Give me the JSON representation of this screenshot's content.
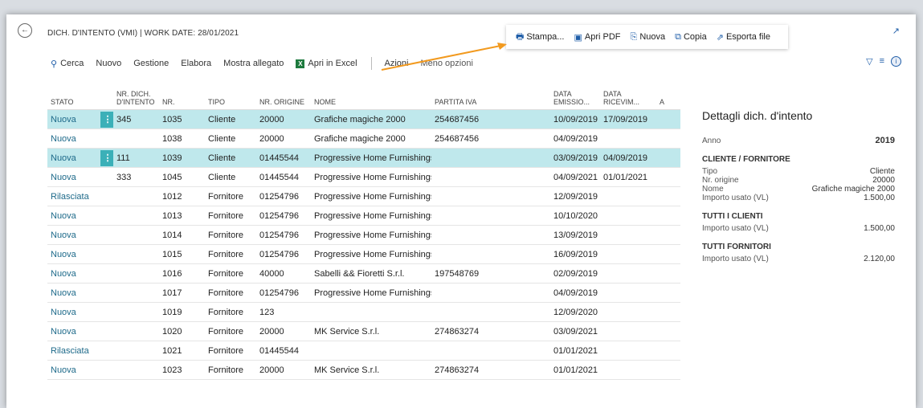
{
  "header": {
    "title": "DICH. D'INTENTO (VMI) | WORK DATE: 28/01/2021"
  },
  "float_actions": [
    {
      "label": "Stampa...",
      "icon": "printer-icon",
      "glyph": "🖶"
    },
    {
      "label": "Apri PDF",
      "icon": "save-icon",
      "glyph": "▣"
    },
    {
      "label": "Nuova",
      "icon": "new-document-icon",
      "glyph": "⎘"
    },
    {
      "label": "Copia",
      "icon": "copy-icon",
      "glyph": "⧉"
    },
    {
      "label": "Esporta file",
      "icon": "export-icon",
      "glyph": "⇗"
    }
  ],
  "actions": {
    "search": "Cerca",
    "new": "Nuovo",
    "manage": "Gestione",
    "process": "Elabora",
    "show_attachment": "Mostra allegato",
    "open_excel": "Apri in Excel",
    "actions": "Azioni",
    "fewer_options": "Meno opzioni"
  },
  "columns": [
    "STATO",
    "",
    "NR. DICH. D'INTENTO",
    "NR.",
    "TIPO",
    "NR. ORIGINE",
    "NOME",
    "PARTITA IVA",
    "DATA EMISSIO...",
    "DATA RICEVIM...",
    "A"
  ],
  "rows": [
    {
      "stato": "Nuova",
      "menu": true,
      "nr_dich": "345",
      "nr": "1035",
      "tipo": "Cliente",
      "origine": "20000",
      "nome": "Grafiche magiche 2000",
      "piva": "254687456",
      "emiss": "10/09/2019",
      "ricev": "17/09/2019",
      "sel": true
    },
    {
      "stato": "Nuova",
      "menu": false,
      "nr_dich": "",
      "nr": "1038",
      "tipo": "Cliente",
      "origine": "20000",
      "nome": "Grafiche magiche 2000",
      "piva": "254687456",
      "emiss": "04/09/2019",
      "ricev": "",
      "sel": false
    },
    {
      "stato": "Nuova",
      "menu": true,
      "nr_dich": "111",
      "nr": "1039",
      "tipo": "Cliente",
      "origine": "01445544",
      "nome": "Progressive Home Furnishings",
      "piva": "",
      "emiss": "03/09/2019",
      "ricev": "04/09/2019",
      "sel": true
    },
    {
      "stato": "Nuova",
      "menu": false,
      "nr_dich": "333",
      "nr": "1045",
      "tipo": "Cliente",
      "origine": "01445544",
      "nome": "Progressive Home Furnishings",
      "piva": "",
      "emiss": "04/09/2021",
      "ricev": "01/01/2021",
      "sel": false
    },
    {
      "stato": "Rilasciata",
      "menu": false,
      "nr_dich": "",
      "nr": "1012",
      "tipo": "Fornitore",
      "origine": "01254796",
      "nome": "Progressive Home Furnishings",
      "piva": "",
      "emiss": "12/09/2019",
      "ricev": "",
      "sel": false
    },
    {
      "stato": "Nuova",
      "menu": false,
      "nr_dich": "",
      "nr": "1013",
      "tipo": "Fornitore",
      "origine": "01254796",
      "nome": "Progressive Home Furnishings",
      "piva": "",
      "emiss": "10/10/2020",
      "ricev": "",
      "sel": false
    },
    {
      "stato": "Nuova",
      "menu": false,
      "nr_dich": "",
      "nr": "1014",
      "tipo": "Fornitore",
      "origine": "01254796",
      "nome": "Progressive Home Furnishings",
      "piva": "",
      "emiss": "13/09/2019",
      "ricev": "",
      "sel": false
    },
    {
      "stato": "Nuova",
      "menu": false,
      "nr_dich": "",
      "nr": "1015",
      "tipo": "Fornitore",
      "origine": "01254796",
      "nome": "Progressive Home Furnishings",
      "piva": "",
      "emiss": "16/09/2019",
      "ricev": "",
      "sel": false
    },
    {
      "stato": "Nuova",
      "menu": false,
      "nr_dich": "",
      "nr": "1016",
      "tipo": "Fornitore",
      "origine": "40000",
      "nome": "Sabelli && Fioretti S.r.l.",
      "piva": "197548769",
      "emiss": "02/09/2019",
      "ricev": "",
      "sel": false
    },
    {
      "stato": "Nuova",
      "menu": false,
      "nr_dich": "",
      "nr": "1017",
      "tipo": "Fornitore",
      "origine": "01254796",
      "nome": "Progressive Home Furnishings",
      "piva": "",
      "emiss": "04/09/2019",
      "ricev": "",
      "sel": false
    },
    {
      "stato": "Nuova",
      "menu": false,
      "nr_dich": "",
      "nr": "1019",
      "tipo": "Fornitore",
      "origine": "123",
      "nome": "",
      "piva": "",
      "emiss": "12/09/2020",
      "ricev": "",
      "sel": false
    },
    {
      "stato": "Nuova",
      "menu": false,
      "nr_dich": "",
      "nr": "1020",
      "tipo": "Fornitore",
      "origine": "20000",
      "nome": "MK Service S.r.l.",
      "piva": "274863274",
      "emiss": "03/09/2021",
      "ricev": "",
      "sel": false
    },
    {
      "stato": "Rilasciata",
      "menu": false,
      "nr_dich": "",
      "nr": "1021",
      "tipo": "Fornitore",
      "origine": "01445544",
      "nome": "",
      "piva": "",
      "emiss": "01/01/2021",
      "ricev": "",
      "sel": false
    },
    {
      "stato": "Nuova",
      "menu": false,
      "nr_dich": "",
      "nr": "1023",
      "tipo": "Fornitore",
      "origine": "20000",
      "nome": "MK Service S.r.l.",
      "piva": "274863274",
      "emiss": "01/01/2021",
      "ricev": "",
      "sel": false
    }
  ],
  "factbox": {
    "title": "Dettagli dich. d'intento",
    "anno_label": "Anno",
    "anno_value": "2019",
    "sec1": "CLIENTE / FORNITORE",
    "tipo_label": "Tipo",
    "tipo_value": "Cliente",
    "origine_label": "Nr. origine",
    "origine_value": "20000",
    "nome_label": "Nome",
    "nome_value": "Grafiche magiche 2000",
    "importo_label": "Importo usato (VL)",
    "importo_value": "1.500,00",
    "sec2": "TUTTI I CLIENTI",
    "clienti_label": "Importo usato (VL)",
    "clienti_value": "1.500,00",
    "sec3": "TUTTI FORNITORI",
    "fornitori_label": "Importo usato (VL)",
    "fornitori_value": "2.120,00"
  },
  "colors": {
    "accent": "#1e5da8",
    "selected_row": "#bfe8ec",
    "menu_button": "#3bb0b8",
    "arrow": "#f29a1f"
  }
}
